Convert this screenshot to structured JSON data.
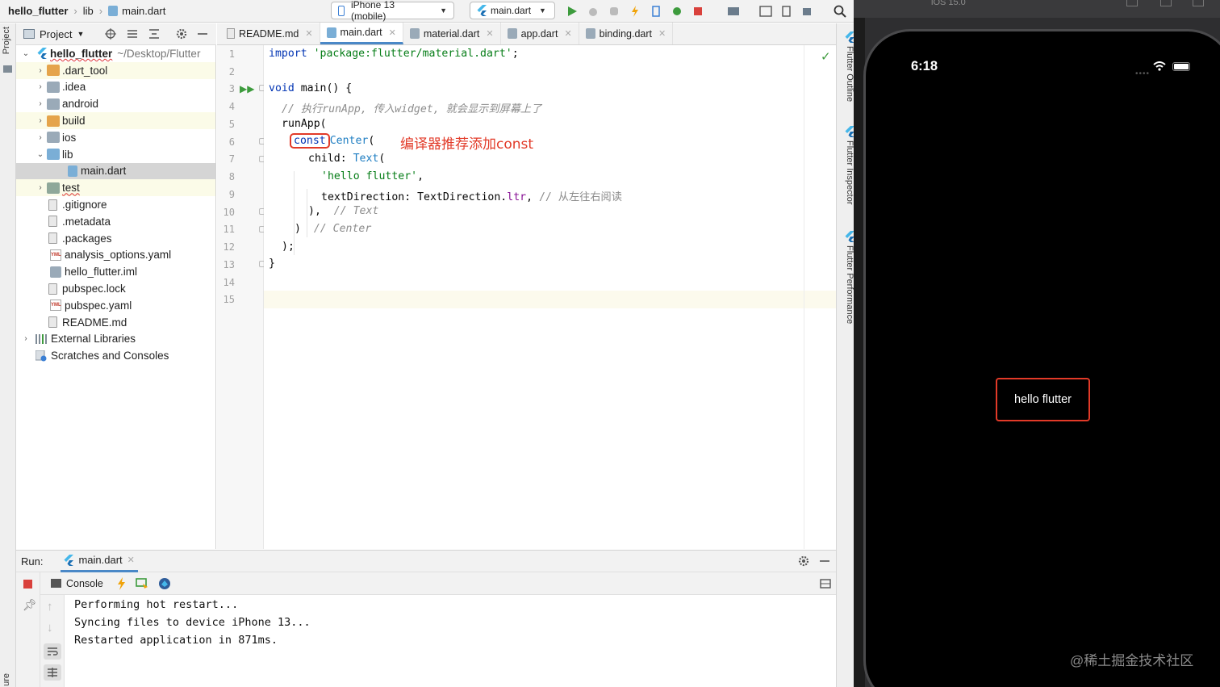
{
  "breadcrumb": {
    "project": "hello_flutter",
    "folder": "lib",
    "file": "main.dart"
  },
  "toolbar": {
    "device": "iPhone 13 (mobile)",
    "run_config": "main.dart"
  },
  "left_strip": {
    "project_label": "Project",
    "structure_label": "ure"
  },
  "project_panel": {
    "title": "Project",
    "root_name": "hello_flutter",
    "root_path": "~/Desktop/Flutter",
    "items": [
      {
        "label": ".dart_tool"
      },
      {
        "label": ".idea"
      },
      {
        "label": "android"
      },
      {
        "label": "build"
      },
      {
        "label": "ios"
      },
      {
        "label": "lib"
      },
      {
        "label": "main.dart"
      },
      {
        "label": "test"
      },
      {
        "label": ".gitignore"
      },
      {
        "label": ".metadata"
      },
      {
        "label": ".packages"
      },
      {
        "label": "analysis_options.yaml"
      },
      {
        "label": "hello_flutter.iml"
      },
      {
        "label": "pubspec.lock"
      },
      {
        "label": "pubspec.yaml"
      },
      {
        "label": "README.md"
      },
      {
        "label": "External Libraries"
      },
      {
        "label": "Scratches and Consoles"
      }
    ]
  },
  "tabs": [
    {
      "label": "README.md"
    },
    {
      "label": "main.dart"
    },
    {
      "label": "material.dart"
    },
    {
      "label": "app.dart"
    },
    {
      "label": "binding.dart"
    }
  ],
  "editor": {
    "line_numbers": [
      "1",
      "2",
      "3",
      "4",
      "5",
      "6",
      "7",
      "8",
      "9",
      "10",
      "11",
      "12",
      "13",
      "14",
      "15"
    ],
    "code": {
      "l1_kw": "import",
      "l1_str": "'package:flutter/material.dart'",
      "l1_end": ";",
      "l3_kw": "void",
      "l3_rest": " main() {",
      "l4_comment": "// 执行runApp, 传入widget, 就会显示到屏幕上了",
      "l5": "runApp(",
      "l6_const": "const",
      "l6_cls": "Center",
      "l6_paren": "(",
      "l7_prop": "child: ",
      "l7_cls": "Text",
      "l7_paren": "(",
      "l8_str": "'hello flutter'",
      "l8_end": ",",
      "l9_a": "textDirection: TextDirection.",
      "l9_prop": "ltr",
      "l9_b": ", ",
      "l9_comment": "// 从左往右阅读",
      "l10_a": "),  ",
      "l10_comment": "// Text",
      "l11_a": ")  ",
      "l11_comment": "// Center",
      "l12": ");",
      "l13": "}"
    },
    "annotation": "编译器推荐添加const"
  },
  "right_strip": {
    "outline": "Flutter Outline",
    "inspector": "Flutter Inspector",
    "performance": "Flutter Performance"
  },
  "run_panel": {
    "label": "Run:",
    "tab": "main.dart",
    "console_tab": "Console",
    "output": [
      "Performing hot restart...",
      "Syncing files to device iPhone 13...",
      "Restarted application in 871ms."
    ]
  },
  "simulator": {
    "ios_version": "iOS 15.0",
    "time": "6:18",
    "app_text": "hello flutter",
    "watermark": "@稀土掘金技术社区"
  },
  "colors": {
    "annotation_red": "#e23a28",
    "keyword_blue": "#0033b3",
    "string_green": "#067d17",
    "class_blue": "#1d7dc2",
    "accent_blue": "#4a88c7"
  }
}
